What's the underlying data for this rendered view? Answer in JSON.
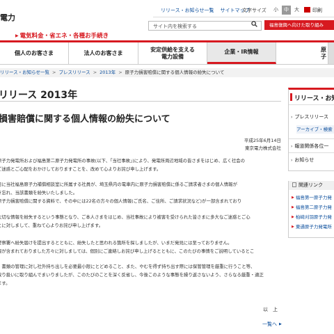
{
  "header": {
    "logo_text": "電力",
    "top_links": [
      "リリース・お知らせ一覧",
      "サイトマップ"
    ],
    "font_size_label": "文字サイズ",
    "font_sizes": [
      "小",
      "中",
      "大"
    ],
    "print_label": "印刷",
    "search_placeholder": "サイト内を検索する",
    "search_icon": "search-icon",
    "red_button": "福島復興へ向けた取り組み",
    "tagline": "電気料金・省エネ・各種お手続き"
  },
  "nav": {
    "items": [
      {
        "label": "個人のお客さま"
      },
      {
        "label": "法人のお客さま"
      },
      {
        "label": "安定供給を支える\n電力設備"
      },
      {
        "label": "企業・IR情報"
      },
      {
        "label": "原子"
      }
    ]
  },
  "breadcrumb": {
    "items": [
      "リリース・お知らせ一覧",
      "プレスリリース",
      "2013年"
    ],
    "current": "原子力損害賠償に関する個人情報の紛失について"
  },
  "main": {
    "heading": "リリース 2013年",
    "title": "損害賠償に関する個人情報の紛失について",
    "date": "平成25年6月14日",
    "company": "東京電力株式会社",
    "paragraphs": [
      "原子力発電所および福島第二原子力発電所の事故(以下、「当社事故」)により、発電所周辺地域の皆さまをはじめ、広く社会の",
      "ご迷惑とご心配をおかけしておりますことを、改めて心よりお詫び申し上げます。",
      "日に当社福島原子力補償相談室に所属する社員が、埼玉県内の電車内に原子力損害賠償に係るご請求者さまの個人情報が",
      "き忘れ、当該書類を紛失いたしました。",
      "原子力損害賠償に関する資料で、その中には22名の方々の個人情報(ご氏名、ご住所、ご請求状況など)が一部含まれており",
      "大切な情報を紛失するという事態となり、ご本人さまをはじめ、当社事故により被害を受けられた皆さまに多大なご迷惑とご心",
      "とに対しまして、重ねて心よりお詫び申し上げます。",
      "警察署へ紛失届けを提出するとともに、紛失したと思われる箇所を探しましたが、いまだ発見には至っておりません。",
      "報が含まれておりました方々に対しましては、個別にご連絡しお詫び申し上げるとともに、このたびの事情をご説明しているとこ",
      "、書類の管理に対し社外持ち出しを必要最小限にとどめること、また、やむを得ず持ち出す際には保管管理を厳重に行うこと等、",
      "取り扱いに取り組んでまいりましたが、このたびのことを深く反省し、今後このような事態を繰り返さないよう、さらなる厳重・適正",
      "ます。"
    ],
    "ijo": "以　上",
    "back_link": "一覧へ"
  },
  "sidebar": {
    "title": "リリース・お知",
    "items": [
      {
        "label": "プレスリリース",
        "sub": "アーカイブ・検索"
      },
      {
        "label": "報道関係各位一"
      },
      {
        "label": "お知らせ"
      }
    ],
    "related_title": "関連リンク",
    "related": [
      "福島第一原子力発",
      "福島第二原子力発",
      "柏崎刈羽原子力発",
      "東通原子力発電所"
    ]
  },
  "colors": {
    "brand_red": "#d71920",
    "link_blue": "#0a4d9c"
  }
}
